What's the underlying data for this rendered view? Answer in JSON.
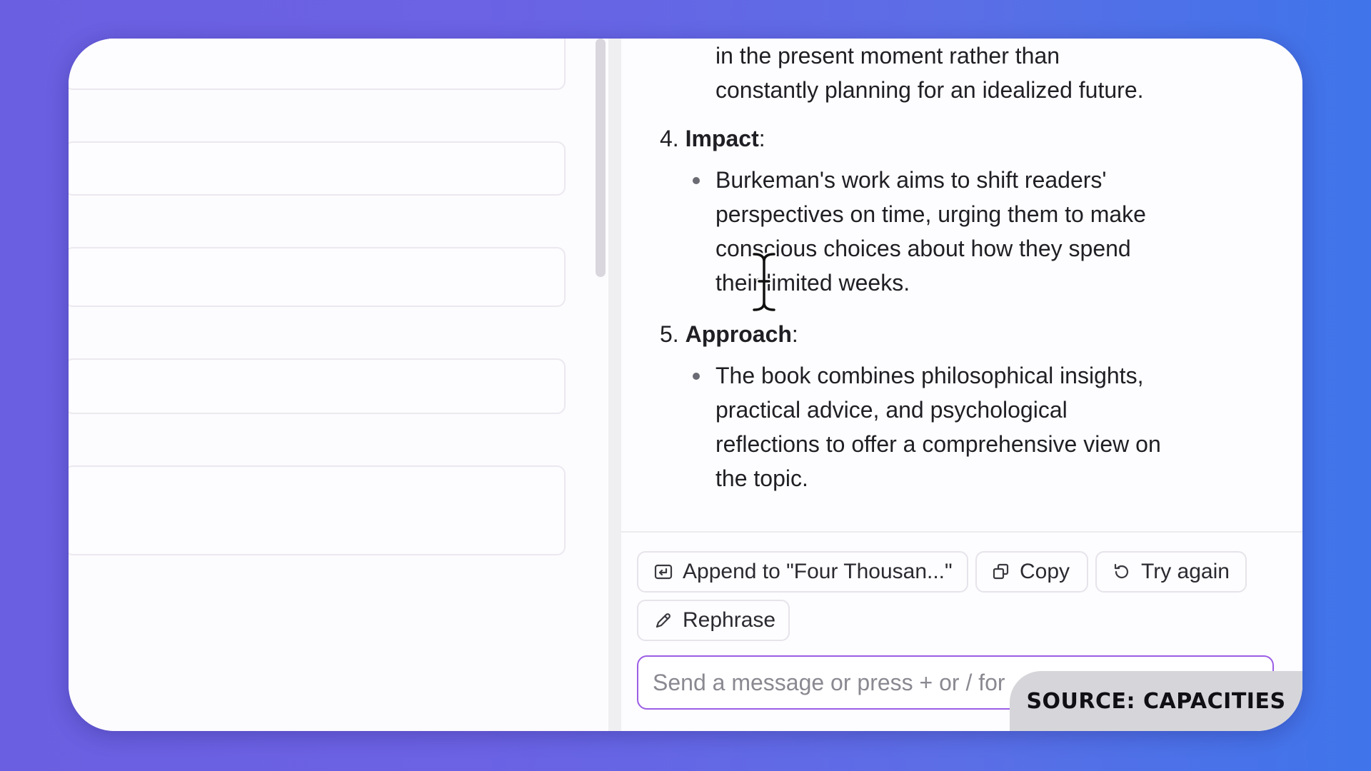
{
  "chat": {
    "intro_lines": [
      "in the present moment rather than",
      "constantly planning for an idealized future."
    ],
    "sections": [
      {
        "number": "4.",
        "heading": "Impact",
        "lines": [
          "Burkeman's work aims to shift readers'",
          "perspectives on time, urging them to make",
          "conscious choices about how they spend",
          "their limited weeks."
        ]
      },
      {
        "number": "5.",
        "heading": "Approach",
        "lines": [
          "The book combines philosophical insights,",
          "practical advice, and psychological",
          "reflections to offer a comprehensive view on",
          "the topic."
        ]
      }
    ]
  },
  "actions": {
    "append_label": "Append to \"Four Thousan...\"",
    "copy_label": "Copy",
    "try_again_label": "Try again",
    "rephrase_label": "Rephrase"
  },
  "composer": {
    "placeholder": "Send a message or press + or / for"
  },
  "overlay": {
    "source_text": "SOURCE: CAPACITIES"
  }
}
